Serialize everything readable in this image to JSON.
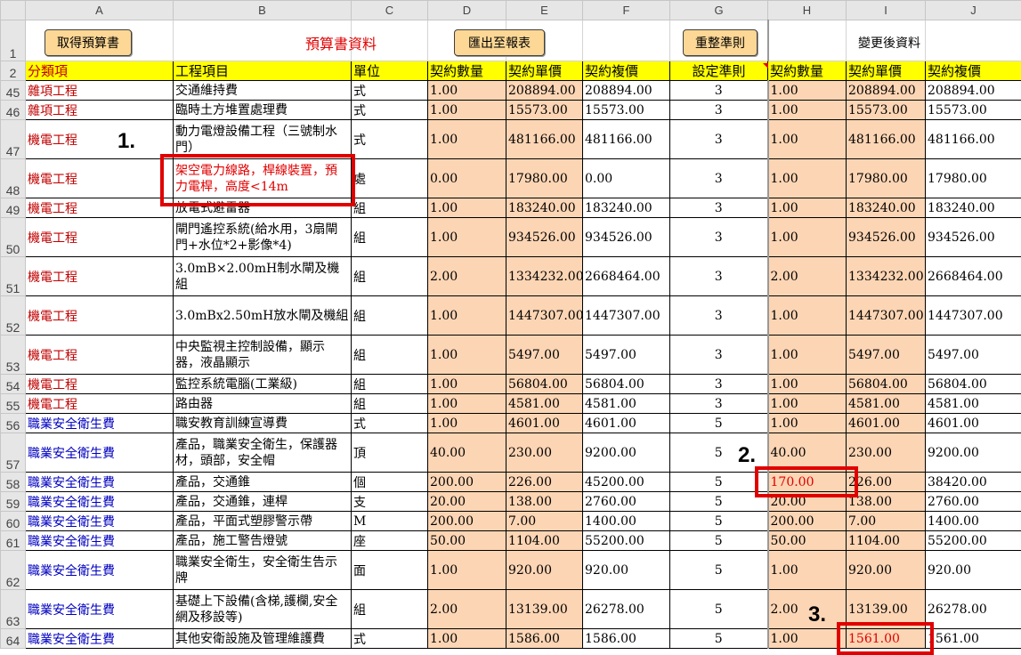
{
  "columns": [
    "A",
    "B",
    "C",
    "D",
    "E",
    "F",
    "G",
    "H",
    "I",
    "J"
  ],
  "row1": {
    "row_number": "1",
    "get_budget_button": "取得預算書",
    "budget_title": "預算書資料",
    "export_button": "匯出至報表",
    "reset_rule_button": "重整準則",
    "changed_title": "變更後資料"
  },
  "header_row": {
    "row_number": "2",
    "cells": [
      "分類項",
      "工程項目",
      "單位",
      "契約數量",
      "契約單價",
      "契約複價",
      "設定準則",
      "契約數量",
      "契約單價",
      "契約複價"
    ]
  },
  "rows": [
    {
      "n": "45",
      "cat": "雜項工程",
      "color": "red",
      "item": "交通維持費",
      "unit": "式",
      "qty": "1.00",
      "price": "208894.00",
      "total": "208894.00",
      "rule": "3",
      "nqty": "1.00",
      "nprice": "208894.00",
      "ntotal": "208894.00"
    },
    {
      "n": "46",
      "cat": "雜項工程",
      "color": "red",
      "item": "臨時土方堆置處理費",
      "unit": "式",
      "qty": "1.00",
      "price": "15573.00",
      "total": "15573.00",
      "rule": "3",
      "nqty": "1.00",
      "nprice": "15573.00",
      "ntotal": "15573.00"
    },
    {
      "n": "47",
      "cat": "機電工程",
      "color": "red",
      "item": "動力電燈設備工程（三號制水門）",
      "unit": "式",
      "qty": "1.00",
      "price": "481166.00",
      "total": "481166.00",
      "rule": "3",
      "nqty": "1.00",
      "nprice": "481166.00",
      "ntotal": "481166.00"
    },
    {
      "n": "48",
      "cat": "機電工程",
      "color": "red",
      "item": "架空電力線路，桿線裝置，預力電桿，高度<14m",
      "unit": "處",
      "qty": "0.00",
      "price": "17980.00",
      "total": "0.00",
      "rule": "3",
      "nqty": "1.00",
      "nprice": "17980.00",
      "ntotal": "17980.00"
    },
    {
      "n": "49",
      "cat": "機電工程",
      "color": "red",
      "item": "放電式避雷器",
      "unit": "組",
      "qty": "1.00",
      "price": "183240.00",
      "total": "183240.00",
      "rule": "3",
      "nqty": "1.00",
      "nprice": "183240.00",
      "ntotal": "183240.00"
    },
    {
      "n": "50",
      "cat": "機電工程",
      "color": "red",
      "item": "閘門遙控系統(給水用，3扇閘門+水位*2+影像*4)",
      "unit": "組",
      "qty": "1.00",
      "price": "934526.00",
      "total": "934526.00",
      "rule": "3",
      "nqty": "1.00",
      "nprice": "934526.00",
      "ntotal": "934526.00"
    },
    {
      "n": "51",
      "cat": "機電工程",
      "color": "red",
      "item": "3.0mB×2.00mH制水閘及機組",
      "unit": "組",
      "qty": "2.00",
      "price": "1334232.00",
      "total": "2668464.00",
      "rule": "3",
      "nqty": "2.00",
      "nprice": "1334232.00",
      "ntotal": "2668464.00"
    },
    {
      "n": "52",
      "cat": "機電工程",
      "color": "red",
      "item": "3.0mBx2.50mH放水閘及機組",
      "unit": "組",
      "qty": "1.00",
      "price": "1447307.00",
      "total": "1447307.00",
      "rule": "3",
      "nqty": "1.00",
      "nprice": "1447307.00",
      "ntotal": "1447307.00"
    },
    {
      "n": "53",
      "cat": "機電工程",
      "color": "red",
      "item": "中央監視主控制設備，顯示器，液晶顯示",
      "unit": "組",
      "qty": "1.00",
      "price": "5497.00",
      "total": "5497.00",
      "rule": "3",
      "nqty": "1.00",
      "nprice": "5497.00",
      "ntotal": "5497.00"
    },
    {
      "n": "54",
      "cat": "機電工程",
      "color": "red",
      "item": "監控系統電腦(工業級)",
      "unit": "組",
      "qty": "1.00",
      "price": "56804.00",
      "total": "56804.00",
      "rule": "3",
      "nqty": "1.00",
      "nprice": "56804.00",
      "ntotal": "56804.00"
    },
    {
      "n": "55",
      "cat": "機電工程",
      "color": "red",
      "item": "路由器",
      "unit": "組",
      "qty": "1.00",
      "price": "4581.00",
      "total": "4581.00",
      "rule": "3",
      "nqty": "1.00",
      "nprice": "4581.00",
      "ntotal": "4581.00"
    },
    {
      "n": "56",
      "cat": "職業安全衛生費",
      "color": "blue",
      "item": "職安教育訓練宣導費",
      "unit": "式",
      "qty": "1.00",
      "price": "4601.00",
      "total": "4601.00",
      "rule": "5",
      "nqty": "1.00",
      "nprice": "4601.00",
      "ntotal": "4601.00"
    },
    {
      "n": "57",
      "cat": "職業安全衛生費",
      "color": "blue",
      "item": "產品，職業安全衛生，保護器材，頭部，安全帽",
      "unit": "頂",
      "qty": "40.00",
      "price": "230.00",
      "total": "9200.00",
      "rule": "5",
      "nqty": "40.00",
      "nprice": "230.00",
      "ntotal": "9200.00"
    },
    {
      "n": "58",
      "cat": "職業安全衛生費",
      "color": "blue",
      "item": "產品，交通錐",
      "unit": "個",
      "qty": "200.00",
      "price": "226.00",
      "total": "45200.00",
      "rule": "5",
      "nqty": "170.00",
      "nprice": "226.00",
      "ntotal": "38420.00",
      "nqty_red": true
    },
    {
      "n": "59",
      "cat": "職業安全衛生費",
      "color": "blue",
      "item": "產品，交通錐，連桿",
      "unit": "支",
      "qty": "20.00",
      "price": "138.00",
      "total": "2760.00",
      "rule": "5",
      "nqty": "20.00",
      "nprice": "138.00",
      "ntotal": "2760.00"
    },
    {
      "n": "60",
      "cat": "職業安全衛生費",
      "color": "blue",
      "item": "產品，平面式塑膠警示帶",
      "unit": "M",
      "qty": "200.00",
      "price": "7.00",
      "total": "1400.00",
      "rule": "5",
      "nqty": "200.00",
      "nprice": "7.00",
      "ntotal": "1400.00"
    },
    {
      "n": "61",
      "cat": "職業安全衛生費",
      "color": "blue",
      "item": "產品，施工警告燈號",
      "unit": "座",
      "qty": "50.00",
      "price": "1104.00",
      "total": "55200.00",
      "rule": "5",
      "nqty": "50.00",
      "nprice": "1104.00",
      "ntotal": "55200.00"
    },
    {
      "n": "62",
      "cat": "職業安全衛生費",
      "color": "blue",
      "item": "職業安全衛生，安全衛生告示牌",
      "unit": "面",
      "qty": "1.00",
      "price": "920.00",
      "total": "920.00",
      "rule": "5",
      "nqty": "1.00",
      "nprice": "920.00",
      "ntotal": "920.00"
    },
    {
      "n": "63",
      "cat": "職業安全衛生費",
      "color": "blue",
      "item": "基礎上下設備(含梯,護欄,安全網及移設等)",
      "unit": "組",
      "qty": "2.00",
      "price": "13139.00",
      "total": "26278.00",
      "rule": "5",
      "nqty": "2.00",
      "nprice": "13139.00",
      "ntotal": "26278.00"
    },
    {
      "n": "64",
      "cat": "職業安全衛生費",
      "color": "blue",
      "item": "其他安衛設施及管理維護費",
      "unit": "式",
      "qty": "1.00",
      "price": "1586.00",
      "total": "1586.00",
      "rule": "5",
      "nqty": "1.00",
      "nprice": "1561.00",
      "ntotal": "1561.00",
      "nprice_red": true
    }
  ],
  "annotations": [
    "1.",
    "2.",
    "3."
  ]
}
